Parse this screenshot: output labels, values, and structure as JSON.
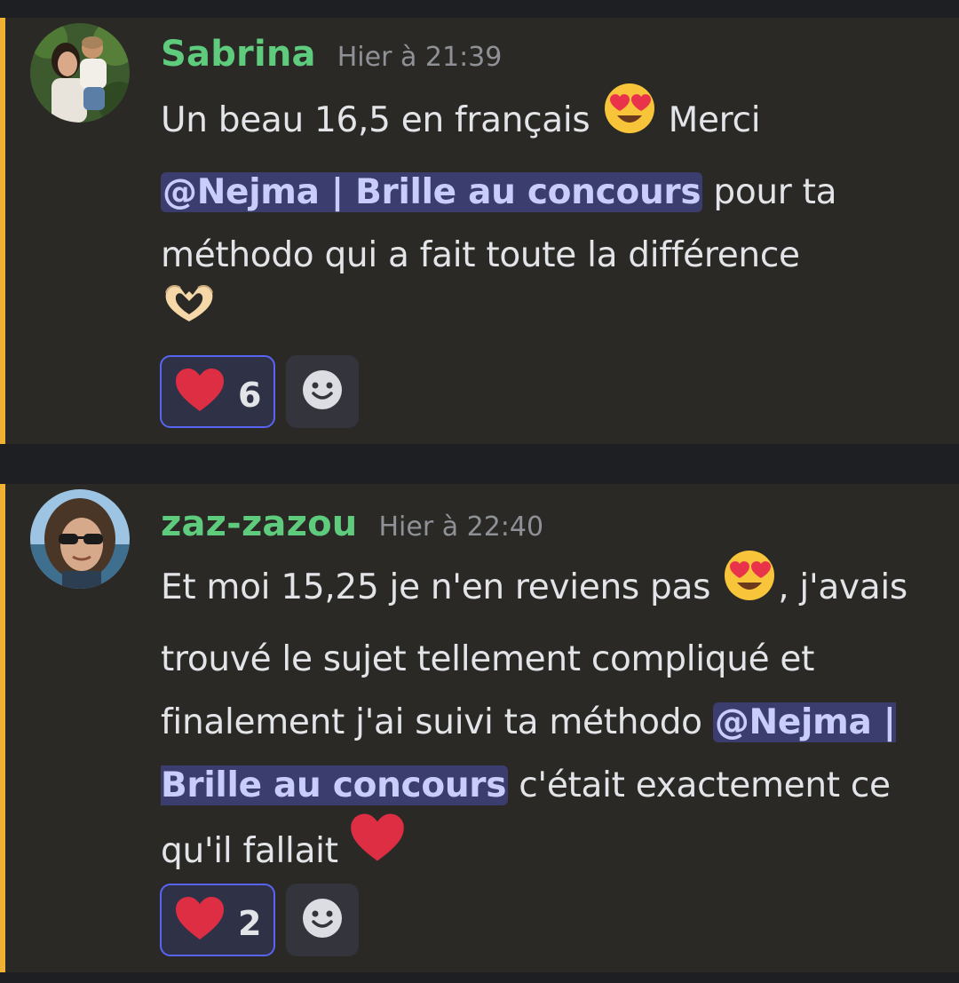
{
  "colors": {
    "username": "#5ecb7d",
    "timestamp": "#8f9197",
    "mention_bg": "#3b3d6e",
    "mention_text": "#c9cdfb",
    "accent_bar": "#f0b232",
    "reaction_border": "#5865f2"
  },
  "messages": [
    {
      "author": "Sabrina",
      "timestamp": "Hier à 21:39",
      "avatar_icon": "user-avatar-photo",
      "text": {
        "part1": "Un beau 16,5 en français ",
        "part2": " Merci ",
        "mention": "@Nejma | Brille au concours",
        "part3": "  pour ta méthodo qui a fait toute la différence "
      },
      "emojis": [
        "heart-eyes-smiley-icon",
        "heart-hands-icon"
      ],
      "reaction": {
        "icon": "red-heart-icon",
        "count": "6"
      },
      "add_reaction_icon": "add-reaction-smiley-icon"
    },
    {
      "author": "zaz-zazou",
      "timestamp": "Hier à 22:40",
      "avatar_icon": "user-avatar-photo",
      "text": {
        "part1": "Et moi 15,25 je n'en reviens pas ",
        "part2": ", j'avais trouvé le sujet tellement compliqué et finalement j'ai suivi ta méthodo ",
        "mention": "@Nejma | Brille au concours",
        "part3": " c'était exactement ce qu'il fallait "
      },
      "emojis": [
        "heart-eyes-smiley-icon",
        "red-heart-icon"
      ],
      "reaction": {
        "icon": "red-heart-icon",
        "count": "2"
      },
      "add_reaction_icon": "add-reaction-smiley-icon"
    }
  ]
}
